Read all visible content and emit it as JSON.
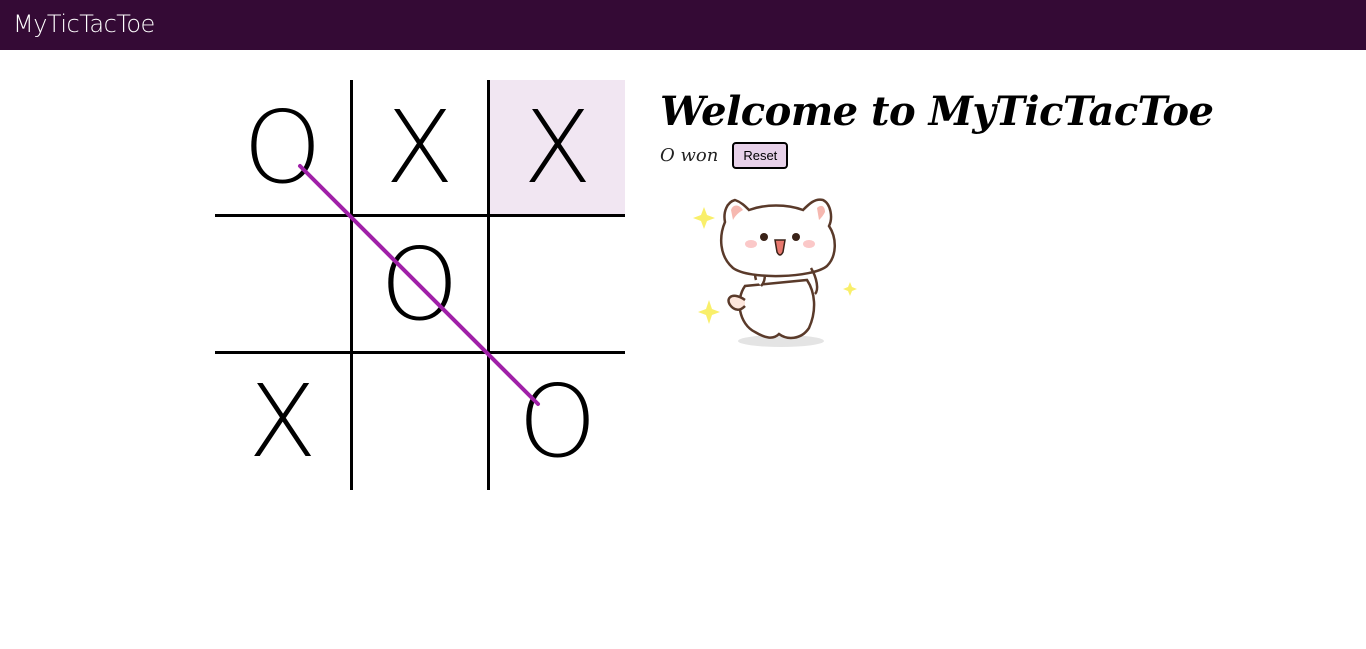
{
  "navbar": {
    "brand": "MyTicTacToe",
    "background": "#340a35"
  },
  "board": {
    "cells": [
      "O",
      "X",
      "X",
      "",
      "O",
      "",
      "X",
      "",
      "O"
    ],
    "highlighted_cell": 2,
    "highlight_color": "#f1e6f2",
    "winning_line": "diagonal-top-left-to-bottom-right",
    "winning_line_color": "#a020a8"
  },
  "panel": {
    "title": "Welcome to MyTicTacToe",
    "status": "O won",
    "reset_label": "Reset"
  },
  "image": {
    "icon": "cat-sticker-icon"
  }
}
